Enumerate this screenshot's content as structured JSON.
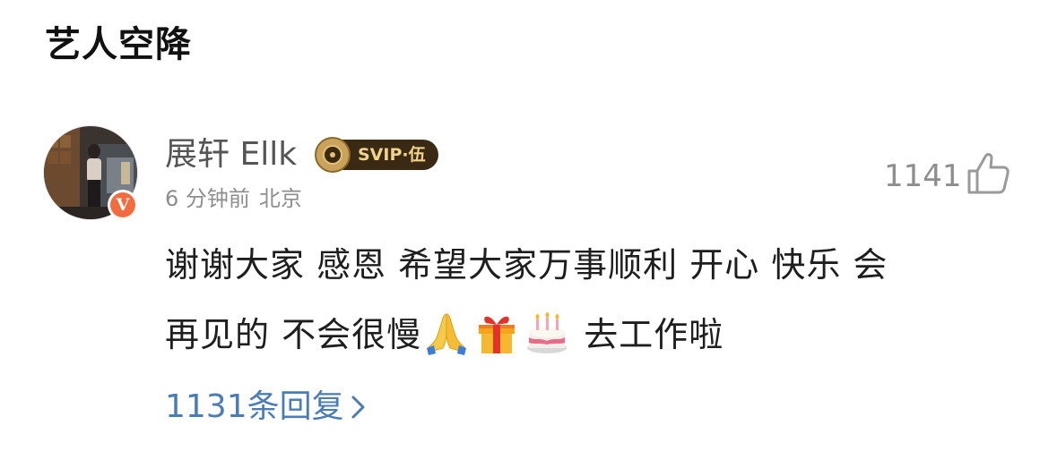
{
  "section": {
    "title": "艺人空降"
  },
  "comment": {
    "author": "展轩 Ellk",
    "badge": "SVIP·伍",
    "time": "6 分钟前",
    "location": "北京",
    "likes": "1141",
    "text_line1": "谢谢大家 感恩 希望大家万事顺利 开心 快乐 会",
    "text_line2_a": "再见的 不会很慢",
    "text_line2_b": "去工作啦",
    "emojis": [
      "folded-hands-emoji",
      "gift-emoji",
      "birthday-cake-emoji"
    ],
    "verified": "V",
    "replies": "1131条回复"
  },
  "colors": {
    "link": "#4c7cb5",
    "meta": "#8e8e8e",
    "verified": "#f26c3f",
    "svip_bg": "#3b2a13",
    "svip_text": "#f0d28b"
  }
}
